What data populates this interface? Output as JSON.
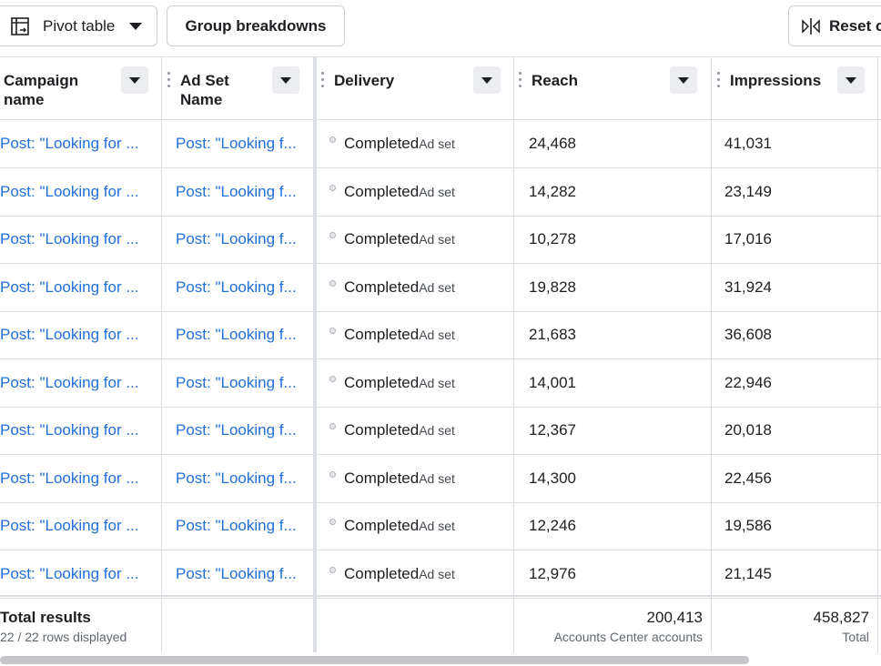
{
  "toolbar": {
    "pivot_label": "Pivot table",
    "group_label": "Group breakdowns",
    "reset_label": "Reset c"
  },
  "columns": {
    "campaign_name": "Campaign name",
    "ad_set_name": "Ad Set Name",
    "delivery": "Delivery",
    "reach": "Reach",
    "impressions": "Impressions"
  },
  "rows": [
    {
      "campaign": "Post: \"Looking for ...",
      "adset": "Post: \"Looking f...",
      "status": "Completed",
      "level": "Ad set",
      "reach": "24,468",
      "impressions": "41,031"
    },
    {
      "campaign": "Post: \"Looking for ...",
      "adset": "Post: \"Looking f...",
      "status": "Completed",
      "level": "Ad set",
      "reach": "14,282",
      "impressions": "23,149"
    },
    {
      "campaign": "Post: \"Looking for ...",
      "adset": "Post: \"Looking f...",
      "status": "Completed",
      "level": "Ad set",
      "reach": "10,278",
      "impressions": "17,016"
    },
    {
      "campaign": "Post: \"Looking for ...",
      "adset": "Post: \"Looking f...",
      "status": "Completed",
      "level": "Ad set",
      "reach": "19,828",
      "impressions": "31,924"
    },
    {
      "campaign": "Post: \"Looking for ...",
      "adset": "Post: \"Looking f...",
      "status": "Completed",
      "level": "Ad set",
      "reach": "21,683",
      "impressions": "36,608"
    },
    {
      "campaign": "Post: \"Looking for ...",
      "adset": "Post: \"Looking f...",
      "status": "Completed",
      "level": "Ad set",
      "reach": "14,001",
      "impressions": "22,946"
    },
    {
      "campaign": "Post: \"Looking for ...",
      "adset": "Post: \"Looking f...",
      "status": "Completed",
      "level": "Ad set",
      "reach": "12,367",
      "impressions": "20,018"
    },
    {
      "campaign": "Post: \"Looking for ...",
      "adset": "Post: \"Looking f...",
      "status": "Completed",
      "level": "Ad set",
      "reach": "14,300",
      "impressions": "22,456"
    },
    {
      "campaign": "Post: \"Looking for ...",
      "adset": "Post: \"Looking f...",
      "status": "Completed",
      "level": "Ad set",
      "reach": "12,246",
      "impressions": "19,586"
    },
    {
      "campaign": "Post: \"Looking for ...",
      "adset": "Post: \"Looking f...",
      "status": "Completed",
      "level": "Ad set",
      "reach": "12,976",
      "impressions": "21,145"
    }
  ],
  "totals": {
    "label": "Total results",
    "rows_displayed": "22 / 22 rows displayed",
    "reach": "200,413",
    "reach_sub": "Accounts Center accounts",
    "impressions": "458,827",
    "impressions_sub": "Total"
  },
  "icons": {
    "pivot": "pivot-table-icon",
    "reset": "reset-columns-icon",
    "sort": "sort-caret-icon",
    "status": "status-dot-icon"
  },
  "colors": {
    "link": "#216fdb",
    "border": "#dadde1",
    "sort_bg": "#ebedf0"
  }
}
